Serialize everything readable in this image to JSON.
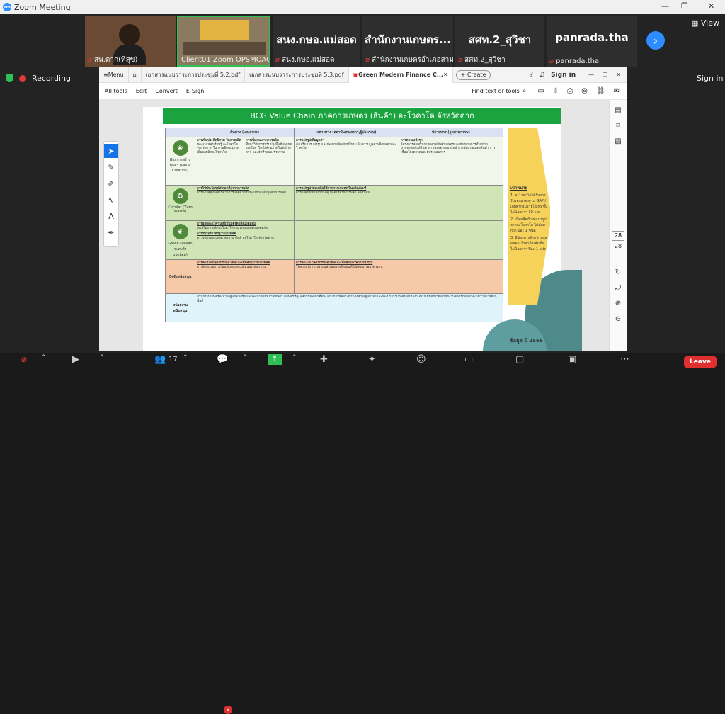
{
  "app": {
    "title": "Zoom Meeting",
    "logo": "zm"
  },
  "participants": [
    {
      "name": "สพ.ตาก(ทิสุข)"
    },
    {
      "name": "Client01 Zoom OPSMOAC"
    },
    {
      "big": "สนง.กษอ.แม่สอด",
      "name": "สนง.กษอ.แม่สอด"
    },
    {
      "big": "สำนักงานเกษตร...",
      "name": "สำนักงานเกษตรอำเภอสาม..."
    },
    {
      "big": "สศท.2_สุวิชา",
      "name": "สศท.2_สุวิชา"
    },
    {
      "big": "panrada.tha",
      "name": "panrada.tha"
    }
  ],
  "view_label": "View",
  "recording_label": "Recording",
  "signin_top": "Sign in",
  "acrobat": {
    "menu_label": "Menu",
    "tabs": [
      "เอกสารแนบวาระการประชุมที่ 5.2.pdf",
      "เอกสารแนบวาระการประชุมที่ 5.3.pdf",
      "Green Modern Finance C..."
    ],
    "create_label": "+ Create",
    "signin_label": "Sign in",
    "tools": [
      "All tools",
      "Edit",
      "Convert",
      "E-Sign"
    ],
    "find_label": "Find text or tools",
    "page_current": "28",
    "page_total": "28"
  },
  "doc": {
    "title": "BCG Value Chain ภาคการเกษตร  (สินค้า) อะโวคาโด  จังหวัดตาก",
    "headers": [
      "",
      "ต้นทาง (เกษตรกร)",
      "กลางทาง (สถาบันเกษตรกร,ผู้ประกอบ)",
      "ปลายทาง (อุตสาหกรรม)"
    ],
    "rows": {
      "bio": {
        "label": "Bio การสร้างมูลค่า (Value Creation)",
        "c1a_title": "การเพิ่มประสิทธิภาพ ในการผลิต",
        "c1a_body": "พัฒนาแหล่งเรียนรู้ อะโวคาโดจังหวัดตาก ในการผลิตคุณภาพ เพิ่มผลผลิตอะโวคาโด",
        "c1b_title": "การเพิ่มคุณภาพการผลิต",
        "c1b_body": "ศึกษาวิจัยการปรับปรุงพื้นที่ปลูกของอะโวคาโดที่มีศักยภาพในจังหวัดตาก และจัดทำแปลงรวบรวม",
        "c2_title": "การแปรรูปเพิ่มมูลค่า",
        "c2_body": "ส่งเสริมการแปรรูปและพัฒนาผลิตภัณฑ์ใหม่ เพิ่มความมูลค่าผลิตผลจากอะโวคาโด",
        "c3_title": "การตลาดเชิงรุก",
        "c3_body": "โครงการส่งเสริมการตลาดสินค้าเกษตรและช่องทางการจำหน่าย ประชาสัมพันธ์สินค้าผ่านช่องทางออนไลน์ การจัดงานแสดงสินค้า การเชื่อมโยงตลาดและผู้ประกอบการ"
      },
      "circular": {
        "label": "Circular (Zero Waste)",
        "c1_title": "การใช้ประโยชน์ส่วนเหลือจากการผลิต",
        "c1_body": "การนำวัสดุเหลือใช้จากการผลิตมาใช้ประโยชน์ เพิ่มมูลค่าการผลิต",
        "c2_title": "การแปรรูปวัสดุเหลือใช้จากการเกษตรเป็นผลิตภัณฑ์",
        "c2_body": "การผลิตปุ๋ยหมักจากวัสดุเหลือใช้จากการผลิต ลดต้นทุน"
      },
      "green": {
        "label": "Green (ลดผลกระทบสิ่งแวดล้อม)",
        "c1a_title": "การผลิตอะโวคาโดที่เป็นมิตรต่อสิ่งแวดล้อม",
        "c1a_body": "ส่งเสริมการผลิตอะโวคาโดตามระบบเกษตรปลอดภัย",
        "c1b_title": "การรับรองมาตรฐานการผลิต",
        "c1b_body": "ตรวจรับรองแปลงมาตรฐาน GAP อะโวคาโด จังหวัดตาก"
      },
      "support": {
        "label": "ปัจจัยสนับสนุน",
        "c1_title": "การพัฒนาเกษตรกรมืออาชีพและเพิ่มศักยภาพการผลิต",
        "c1_body": "การจัดอบรมการเรียนรู้และแลกเปลี่ยนประสบการณ์",
        "c2_title": "การพัฒนาเกษตรกรมืออาชีพและเพิ่มศักยภาพการแปรรูป",
        "c2_body": "ให้ความรู้การแปรรูปและพัฒนาผลิตภัณฑ์ให้มีคุณภาพมาตรฐาน"
      },
      "agency": {
        "label": "หน่วยงานสนับสนุน",
        "body": "สำนักงานเกษตรจังหวัด/ศูนย์ส่งเสริมและพัฒนาอาชีพการเกษตร (เกษตรที่สูง)/สถานีพัฒนาที่ดิน/โครงการชลประทานจังหวัด/ศูนย์วิจัยและพัฒนาการเกษตร/สำนักงานพาณิชย์จังหวัด/สำนักงานสหกรณ์จังหวัด/มหาวิทยาลัยในพื้นที่"
      }
    },
    "goals": {
      "title": "เป้าหมาย",
      "items": [
        "1. อะโวคาโดได้รับการรับรองมาตรฐาน GAP /เกษตรกรมีรายได้เพิ่มขึ้นไม่น้อยกว่า 10 ราย",
        "2. เกิดผลิตภัณฑ์แปรรูปจากอะโวคาโด ไม่น้อยกว่า ปีละ 1 ชนิด",
        "3. มีช่องทางจำหน่ายผลผลิตอะโวคาโดเพิ่มขึ้นไม่น้อยกว่า ปีละ 1 แห่ง"
      ]
    },
    "footer": "ข้อมูล ปี 2566"
  },
  "toolbar": {
    "participants_count": "17",
    "chat_badge": "3",
    "leave_label": "Leave"
  }
}
